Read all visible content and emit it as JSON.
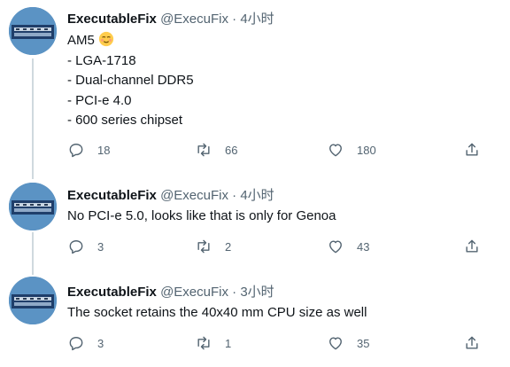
{
  "tweets": [
    {
      "name": "ExecutableFix",
      "handle": "@ExecuFix",
      "separator": "·",
      "time": "4小时",
      "lines": [
        "AM5",
        "- LGA-1718",
        "- Dual-channel DDR5",
        "- PCI-e 4.0",
        "- 600 series chipset"
      ],
      "replies": "18",
      "retweets": "66",
      "likes": "180"
    },
    {
      "name": "ExecutableFix",
      "handle": "@ExecuFix",
      "separator": "·",
      "time": "4小时",
      "lines": [
        "No PCI-e 5.0, looks like that is only for Genoa"
      ],
      "replies": "3",
      "retweets": "2",
      "likes": "43"
    },
    {
      "name": "ExecutableFix",
      "handle": "@ExecuFix",
      "separator": "·",
      "time": "3小时",
      "lines": [
        "The socket retains the 40x40 mm CPU size as well"
      ],
      "replies": "3",
      "retweets": "1",
      "likes": "35"
    }
  ],
  "icons": {
    "reply": "reply-icon",
    "retweet": "retweet-icon",
    "like": "like-icon",
    "share": "share-icon",
    "emoji": "relieved-face-emoji"
  },
  "colors": {
    "text": "#0f1419",
    "muted": "#536471",
    "thread_line": "#cfd9de"
  }
}
